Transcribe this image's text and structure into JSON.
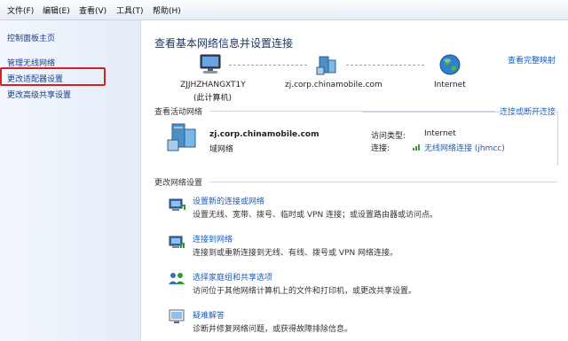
{
  "menu": [
    "文件(F)",
    "编辑(E)",
    "查看(V)",
    "工具(T)",
    "帮助(H)"
  ],
  "sidebar": {
    "home": "控制面板主页",
    "items": [
      "管理无线网络",
      "更改适配器设置",
      "更改高级共享设置"
    ]
  },
  "main": {
    "title": "查看基本网络信息并设置连接",
    "view_full_map": "查看完整映射",
    "nodes": [
      {
        "label_line1": "ZJJHZHANGXT1Y",
        "label_line2": "(此计算机)"
      },
      {
        "label_line1": "zj.corp.chinamobile.com"
      },
      {
        "label_line1": "Internet"
      }
    ],
    "active_section": "查看活动网络",
    "connect_disconnect": "连接或断开连接",
    "network": {
      "name": "zj.corp.chinamobile.com",
      "type": "域网络",
      "access_type_label": "访问类型:",
      "access_type_value": "Internet",
      "connections_label": "连接:",
      "connections_value": "无线网络连接 (jhmcc)"
    },
    "change_section": "更改网络设置",
    "tasks": [
      {
        "title": "设置新的连接或网络",
        "desc": "设置无线、宽带、拨号、临时或 VPN 连接；或设置路由器或访问点。"
      },
      {
        "title": "连接到网络",
        "desc": "连接到或重新连接到无线、有线、拨号或 VPN 网络连接。"
      },
      {
        "title": "选择家庭组和共享选项",
        "desc": "访问位于其他网络计算机上的文件和打印机，或更改共享设置。"
      },
      {
        "title": "疑难解答",
        "desc": "诊断并修复网络问题，或获得故障排除信息。"
      }
    ]
  },
  "colors": {
    "link": "#1a5db7",
    "highlight_border": "#d62020"
  }
}
